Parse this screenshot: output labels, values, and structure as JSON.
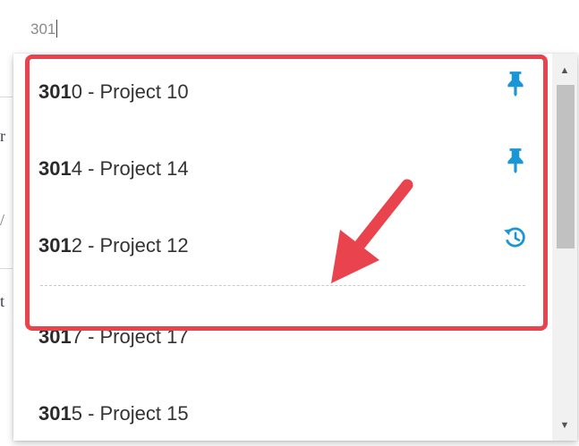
{
  "background": {
    "fragments": [
      "r",
      "/",
      "t"
    ]
  },
  "search": {
    "value": "301"
  },
  "options": [
    {
      "match": "301",
      "rest": "0 - Project 10",
      "icon": "pin-icon"
    },
    {
      "match": "301",
      "rest": "4 - Project 14",
      "icon": "pin-icon"
    },
    {
      "match": "301",
      "rest": "2 - Project 12",
      "icon": "history-icon"
    },
    {
      "match": "301",
      "rest": "7 - Project 17",
      "icon": ""
    },
    {
      "match": "301",
      "rest": "5 - Project 15",
      "icon": ""
    }
  ],
  "colors": {
    "accent": "#1a95d6",
    "highlight": "#e9434d"
  }
}
